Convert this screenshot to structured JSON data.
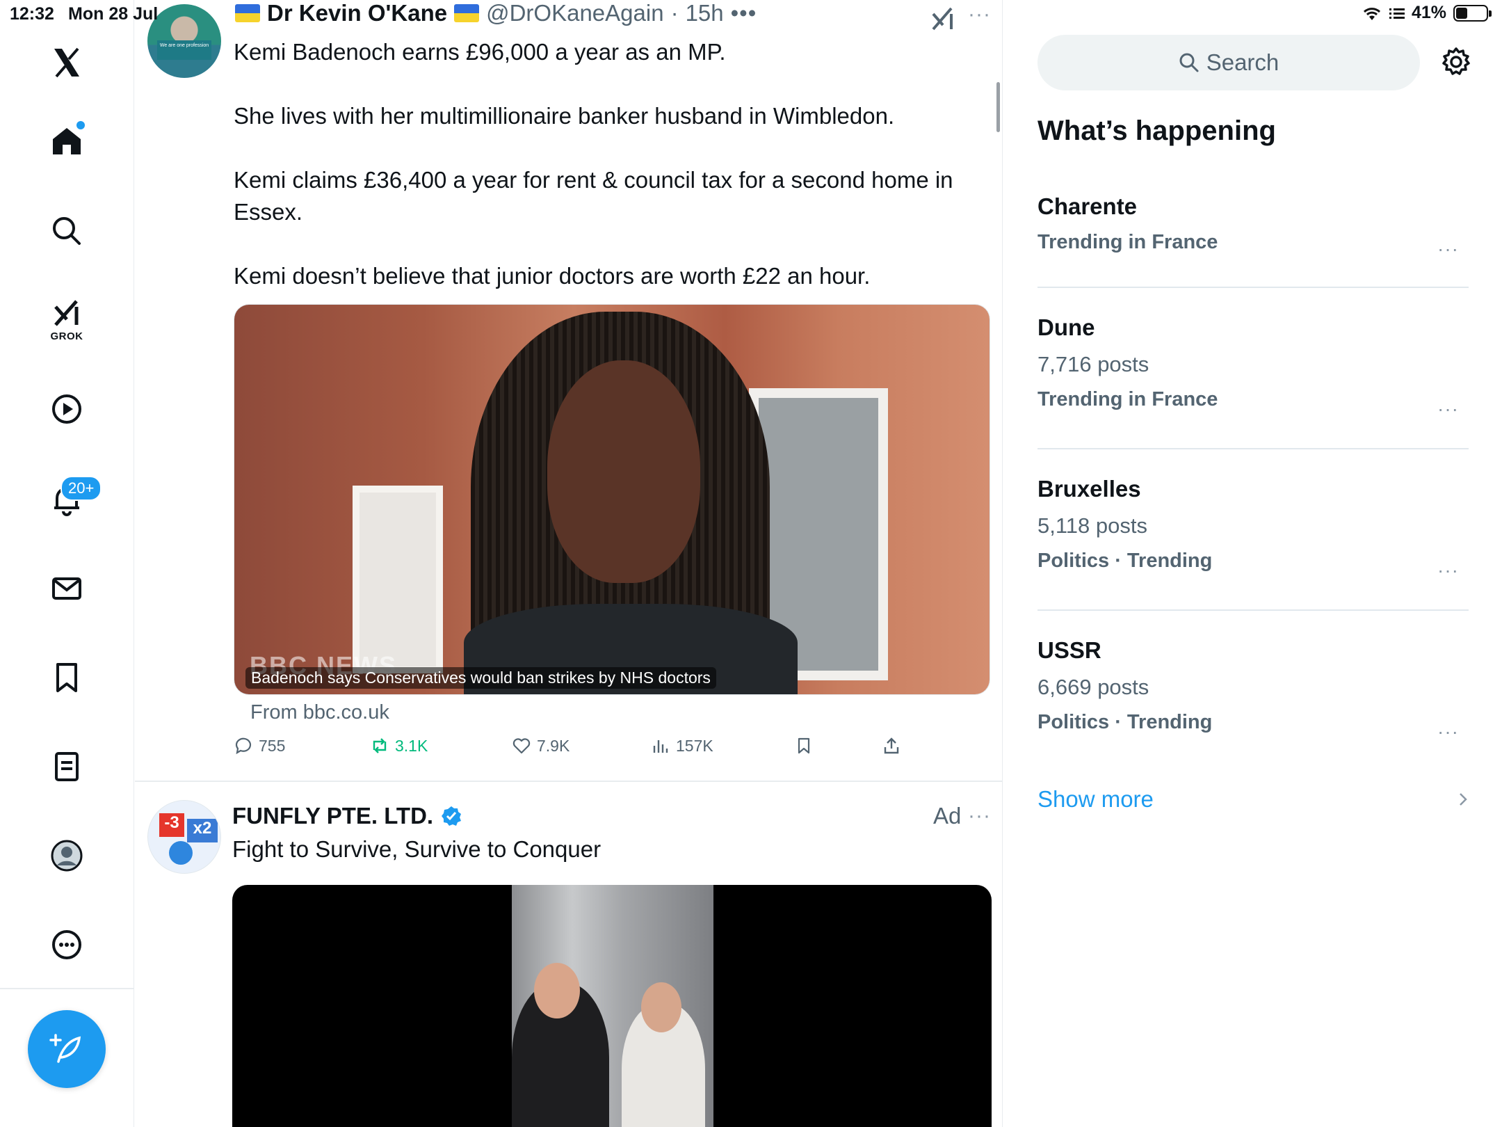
{
  "status_bar": {
    "time": "12:32",
    "date": "Mon 28 Jul",
    "battery": "41%",
    "battery_level": 0.41
  },
  "nav": {
    "grok_label": "GROK",
    "notifications_badge": "20+"
  },
  "tweet": {
    "display_name": "Dr Kevin O'Kane",
    "handle": "@DrOKaneAgain",
    "separator": "·",
    "time": "15h",
    "more_dots": "•••",
    "right_more": "···",
    "paragraphs": [
      "Kemi Badenoch earns £96,000 a year as an MP.",
      "She lives with her multimillionaire banker husband in Wimbledon.",
      "Kemi claims £36,400 a year for rent & council tax for a second home in Essex.",
      "Kemi doesn’t believe that junior doctors are worth £22 an hour."
    ],
    "card_watermark": "BBC NEWS",
    "card_caption": "Badenoch says Conservatives would ban strikes by NHS doctors",
    "card_source": "From bbc.co.uk",
    "replies": "755",
    "reposts": "3.1K",
    "likes": "7.9K",
    "views": "157K",
    "avatar_sign": "We are one profession"
  },
  "ad": {
    "display_name": "FUNFLY PTE. LTD.",
    "label": "Ad",
    "more": "···",
    "text": "Fight to Survive, Survive to Conquer",
    "avatar_badge_1": "-3",
    "avatar_badge_2": "x2"
  },
  "sidebar": {
    "search_placeholder": "Search",
    "heading": "What’s happening",
    "trends": [
      {
        "title": "Charente",
        "posts": "",
        "context": "Trending in France"
      },
      {
        "title": "Dune",
        "posts": "7,716 posts",
        "context": "Trending in France"
      },
      {
        "title": "Bruxelles",
        "posts": "5,118 posts",
        "context": "Politics · Trending"
      },
      {
        "title": "USSR",
        "posts": "6,669 posts",
        "context": "Politics · Trending"
      }
    ],
    "trend_more": "···",
    "show_more": "Show more"
  },
  "colors": {
    "accent": "#1d9bf0",
    "repost": "#00ba7c",
    "muted": "#536471"
  }
}
